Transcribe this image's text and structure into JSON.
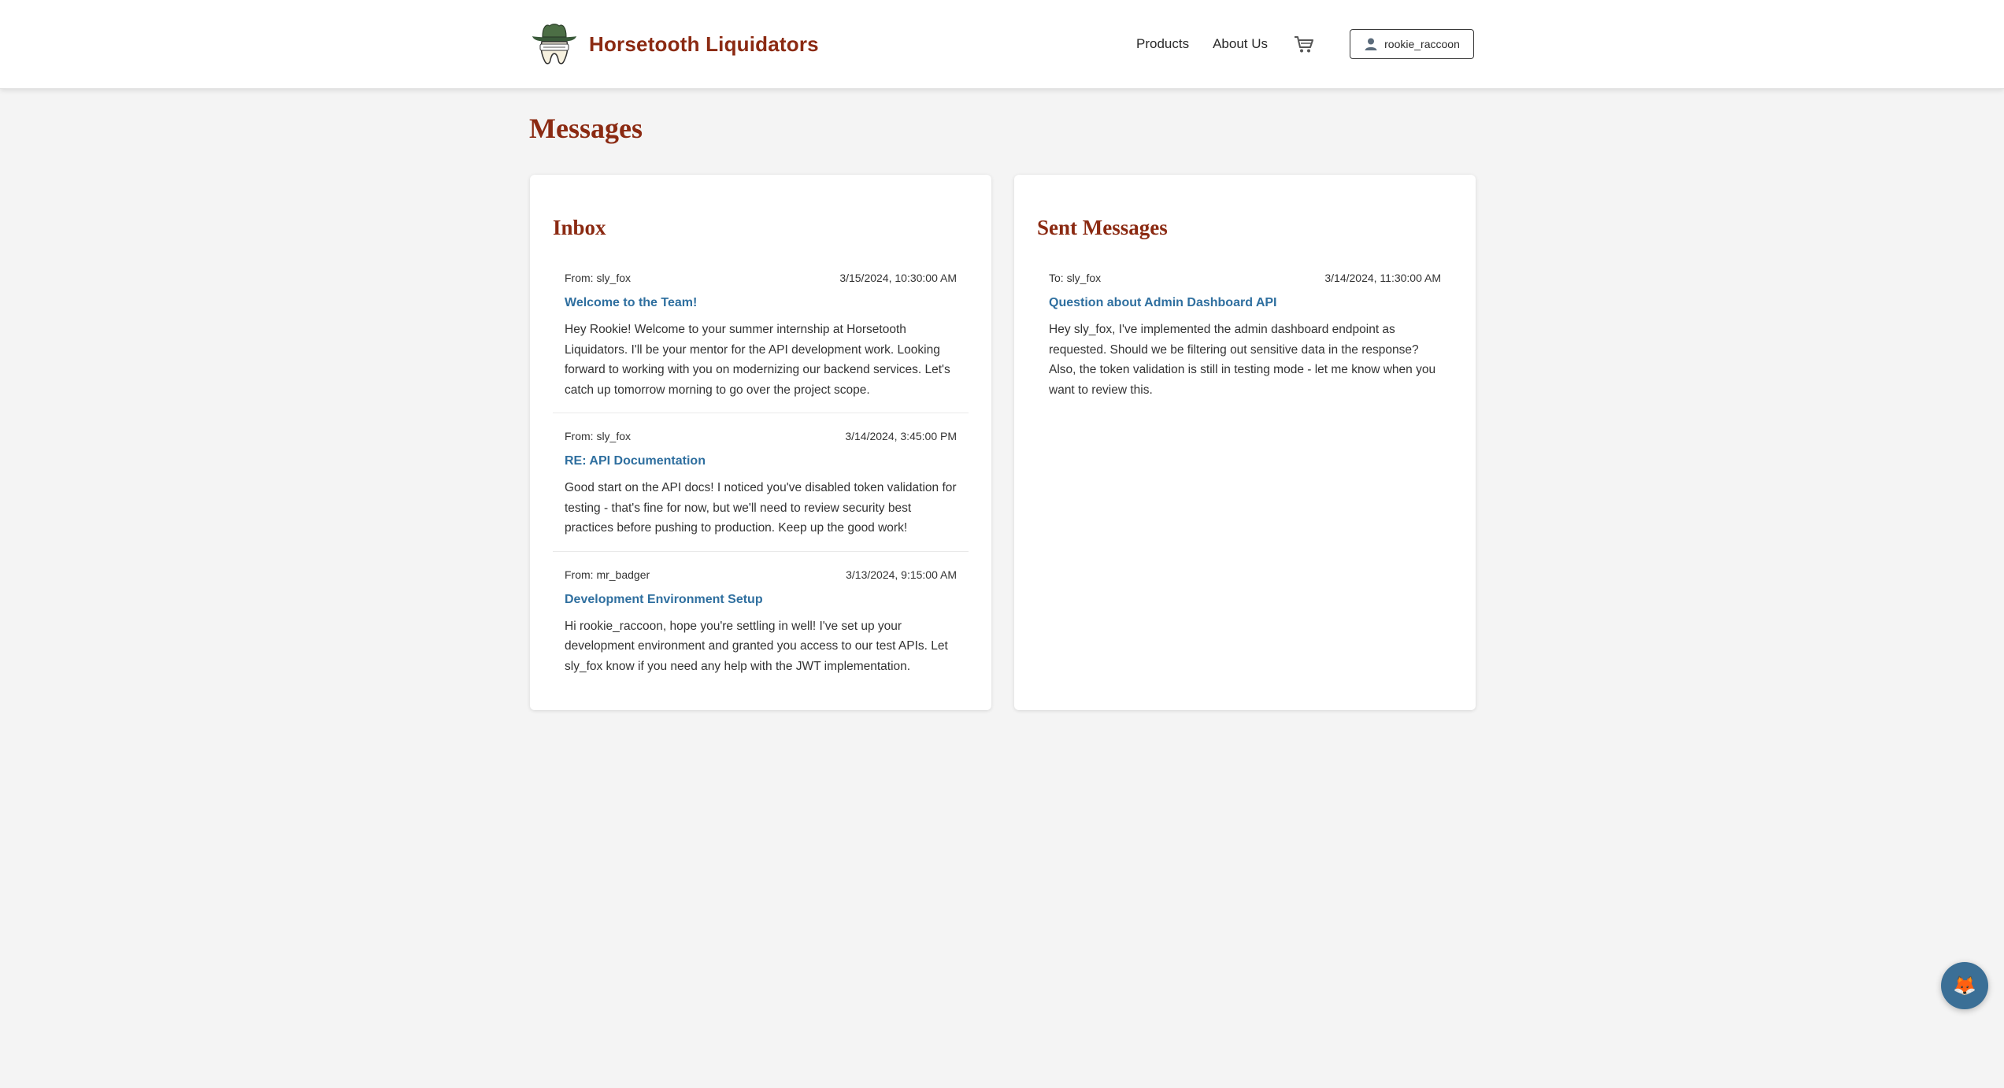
{
  "header": {
    "brand_name": "Horsetooth Liquidators",
    "logo_icon": "tooth-cowboy-hat-logo-icon",
    "nav": {
      "products": "Products",
      "about": "About Us"
    },
    "cart_icon": "shopping-cart-icon",
    "user": {
      "icon": "user-icon",
      "username": "rookie_raccoon"
    }
  },
  "page": {
    "title": "Messages"
  },
  "inbox": {
    "title": "Inbox",
    "messages": [
      {
        "from": "From: sly_fox",
        "timestamp": "3/15/2024, 10:30:00 AM",
        "subject": "Welcome to the Team!",
        "body": "Hey Rookie! Welcome to your summer internship at Horsetooth Liquidators. I'll be your mentor for the API development work. Looking forward to working with you on modernizing our backend services. Let's catch up tomorrow morning to go over the project scope."
      },
      {
        "from": "From: sly_fox",
        "timestamp": "3/14/2024, 3:45:00 PM",
        "subject": "RE: API Documentation",
        "body": "Good start on the API docs! I noticed you've disabled token validation for testing - that's fine for now, but we'll need to review security best practices before pushing to production. Keep up the good work!"
      },
      {
        "from": "From: mr_badger",
        "timestamp": "3/13/2024, 9:15:00 AM",
        "subject": "Development Environment Setup",
        "body": "Hi rookie_raccoon, hope you're settling in well! I've set up your development environment and granted you access to our test APIs. Let sly_fox know if you need any help with the JWT implementation."
      }
    ]
  },
  "sent": {
    "title": "Sent Messages",
    "messages": [
      {
        "to": "To: sly_fox",
        "timestamp": "3/14/2024, 11:30:00 AM",
        "subject": "Question about Admin Dashboard API",
        "body": "Hey sly_fox, I've implemented the admin dashboard endpoint as requested. Should we be filtering out sensitive data in the response? Also, the token validation is still in testing mode - let me know when you want to review this."
      }
    ]
  },
  "fab": {
    "icon": "fox-face-icon",
    "glyph": "🦊"
  },
  "colors": {
    "brand": "#8b2a12",
    "link": "#2f6f9f",
    "background": "#f4f4f4",
    "fab": "#3b6f96"
  }
}
